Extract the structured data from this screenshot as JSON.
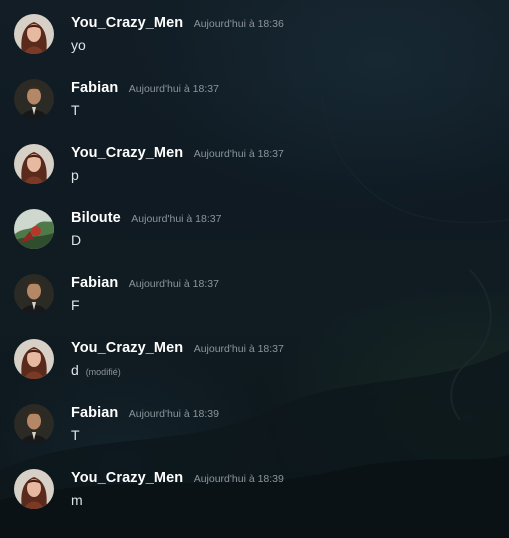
{
  "messages": [
    {
      "author": "You_Crazy_Men",
      "avatar": "woman-portrait-avatar",
      "time": "Aujourd'hui à 18:36",
      "text": "yo",
      "edited": ""
    },
    {
      "author": "Fabian",
      "avatar": "man-portrait-avatar",
      "time": "Aujourd'hui à 18:37",
      "text": "T",
      "edited": ""
    },
    {
      "author": "You_Crazy_Men",
      "avatar": "woman-portrait-avatar",
      "time": "Aujourd'hui à 18:37",
      "text": "p",
      "edited": ""
    },
    {
      "author": "Biloute",
      "avatar": "landscape-avatar",
      "time": "Aujourd'hui à 18:37",
      "text": "D",
      "edited": ""
    },
    {
      "author": "Fabian",
      "avatar": "man-portrait-avatar",
      "time": "Aujourd'hui à 18:37",
      "text": "F",
      "edited": ""
    },
    {
      "author": "You_Crazy_Men",
      "avatar": "woman-portrait-avatar",
      "time": "Aujourd'hui à 18:37",
      "text": "d",
      "edited": "(modifié)"
    },
    {
      "author": "Fabian",
      "avatar": "man-portrait-avatar",
      "time": "Aujourd'hui à 18:39",
      "text": "T",
      "edited": ""
    },
    {
      "author": "You_Crazy_Men",
      "avatar": "woman-portrait-avatar",
      "time": "Aujourd'hui à 18:39",
      "text": "m",
      "edited": ""
    }
  ],
  "colors": {
    "background": "#0f1a22",
    "username": "#ffffff",
    "timestamp": "#8b949b",
    "message_text": "#dfe3e6"
  }
}
